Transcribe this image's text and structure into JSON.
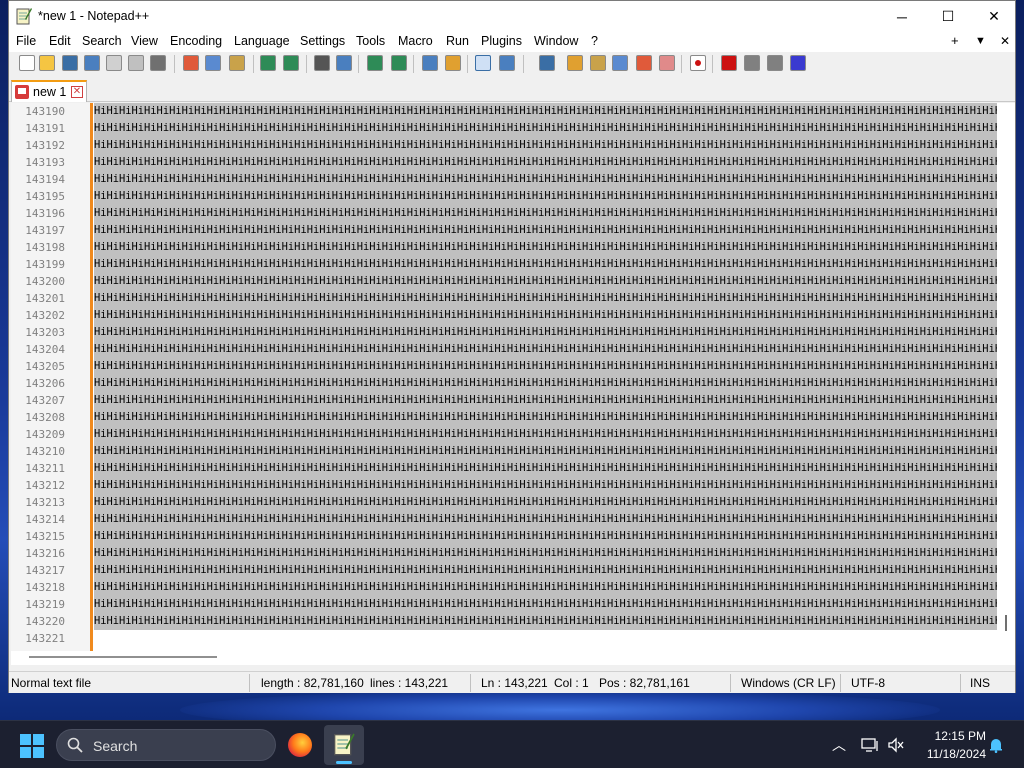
{
  "window": {
    "title": "*new 1 - Notepad++",
    "controls": {
      "minimize": "─",
      "maximize": "☐",
      "close": "✕"
    }
  },
  "menu": {
    "items": [
      "File",
      "Edit",
      "Search",
      "View",
      "Encoding",
      "Language",
      "Settings",
      "Tools",
      "Macro",
      "Run",
      "Plugins",
      "Window",
      "?"
    ],
    "right": {
      "add": "+",
      "dropdown": "▼",
      "close": "✕"
    }
  },
  "toolbar": {
    "icons": [
      "new-file-icon",
      "open-file-icon",
      "save-icon",
      "save-all-icon",
      "close-icon",
      "close-all-icon",
      "print-icon",
      "cut-icon",
      "copy-icon",
      "paste-icon",
      "undo-icon",
      "redo-icon",
      "find-icon",
      "replace-icon",
      "zoom-in-icon",
      "zoom-out-icon",
      "sync-vertical-icon",
      "sync-horizontal-icon",
      "word-wrap-icon",
      "show-all-chars-icon",
      "indent-guide-icon",
      "udl-icon",
      "doc-map-icon",
      "function-list-icon",
      "folder-workspace-icon",
      "monitoring-icon",
      "record-macro-icon",
      "stop-macro-icon",
      "play-macro-icon",
      "run-macro-multiple-icon",
      "save-macro-icon"
    ]
  },
  "tab": {
    "label": "new 1"
  },
  "editor": {
    "line_numbers": [
      "143190",
      "143191",
      "143192",
      "143193",
      "143194",
      "143195",
      "143196",
      "143197",
      "143198",
      "143199",
      "143200",
      "143201",
      "143202",
      "143203",
      "143204",
      "143205",
      "143206",
      "143207",
      "143208",
      "143209",
      "143210",
      "143211",
      "143212",
      "143213",
      "143214",
      "143215",
      "143216",
      "143217",
      "143218",
      "143219",
      "143220",
      "143221"
    ],
    "line_text": "HiHiHiHiHiHiHiHiHiHiHiHiHiHiHiHiHiHiHiHiHiHiHiHiHiHiHiHiHiHiHiHiHiHiHiHiHiHiHiHiHiHiHiHiHiHiHiHiHiHiHiHiHiHiHiHiHiHiHiHiHiHiHiHiHiHiHiHiHiHiHiHiHiHiHiHiHiHiHiHi",
    "last_line_text": ""
  },
  "status": {
    "file_type": "Normal text file",
    "length": "length : 82,781,160",
    "lines": "lines : 143,221",
    "ln": "Ln : 143,221",
    "col": "Col : 1",
    "pos": "Pos : 82,781,161",
    "eol": "Windows (CR LF)",
    "encoding": "UTF-8",
    "mode": "INS"
  },
  "taskbar": {
    "search_label": "Search",
    "clock_time": "12:15 PM",
    "clock_date": "11/18/2024"
  },
  "colors": {
    "selection": "#c0c0c0",
    "fold_margin": "#f08a1e",
    "accent": "#4cc2ff"
  }
}
